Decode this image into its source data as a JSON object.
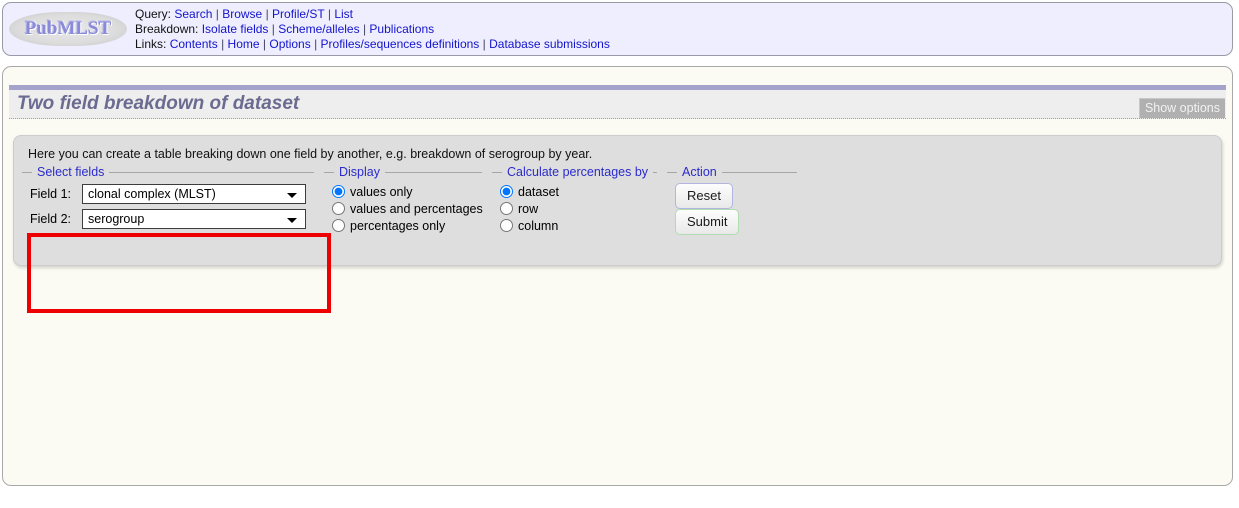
{
  "header": {
    "logo_text": "PubMLST",
    "logo_name": "pubmlst-logo",
    "nav": [
      {
        "label": "Query:",
        "links": [
          "Search",
          "Browse",
          "Profile/ST",
          "List"
        ]
      },
      {
        "label": "Breakdown:",
        "links": [
          "Isolate fields",
          "Scheme/alleles",
          "Publications"
        ]
      },
      {
        "label": "Links:",
        "links": [
          "Contents",
          "Home",
          "Options",
          "Profiles/sequences definitions",
          "Database submissions"
        ]
      }
    ],
    "separator": "|"
  },
  "page": {
    "title": "Two field breakdown of dataset",
    "show_options_label": "Show options"
  },
  "form": {
    "intro": "Here you can create a table breaking down one field by another, e.g. breakdown of serogroup by year.",
    "select_fields": {
      "legend": "Select fields",
      "field1_label": "Field 1:",
      "field1_value": "clonal complex (MLST)",
      "field2_label": "Field 2:",
      "field2_value": "serogroup"
    },
    "display": {
      "legend": "Display",
      "options": [
        {
          "label": "values only",
          "selected": true
        },
        {
          "label": "values and percentages",
          "selected": false
        },
        {
          "label": "percentages only",
          "selected": false
        }
      ]
    },
    "percentages": {
      "legend": "Calculate percentages by",
      "options": [
        {
          "label": "dataset",
          "selected": true
        },
        {
          "label": "row",
          "selected": false
        },
        {
          "label": "column",
          "selected": false
        }
      ]
    },
    "action": {
      "legend": "Action",
      "reset_label": "Reset",
      "submit_label": "Submit"
    }
  },
  "colors": {
    "header_bg": "#eeeeff",
    "content_bg": "#fbfbf3",
    "form_bg": "#dedede",
    "title_color": "#6b6b91",
    "title_rule": "#a3a3cc",
    "link_color": "#1414cc",
    "legend_color": "#2b2bcc",
    "highlight_box": "#ee0000",
    "show_options_bg": "#b0b0b0"
  }
}
